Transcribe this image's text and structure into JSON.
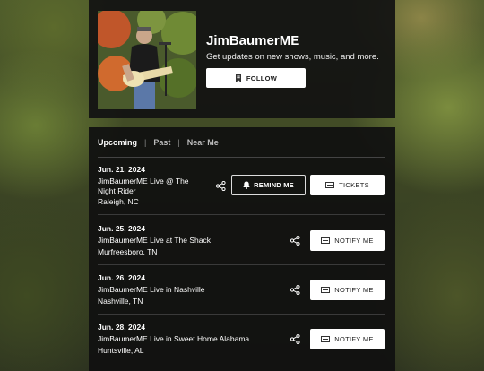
{
  "artist": {
    "name": "JimBaumerME",
    "tagline": "Get updates on new shows, music, and more.",
    "follow_label": "FOLLOW"
  },
  "tabs": [
    {
      "label": "Upcoming",
      "active": true
    },
    {
      "label": "Past",
      "active": false
    },
    {
      "label": "Near Me",
      "active": false
    }
  ],
  "events": [
    {
      "date": "Jun. 21, 2024",
      "title_line1": "JimBaumerME Live @ The",
      "title_line2": "Night Rider",
      "location": "Raleigh, NC",
      "action_label": "REMIND ME",
      "tickets_label": "TICKETS"
    },
    {
      "date": "Jun. 25, 2024",
      "title_line1": "JimBaumerME Live at The Shack",
      "location": "Murfreesboro, TN",
      "action_label": "NOTIFY ME"
    },
    {
      "date": "Jun. 26, 2024",
      "title_line1": "JimBaumerME Live in Nashville",
      "location": "Nashville, TN",
      "action_label": "NOTIFY ME"
    },
    {
      "date": "Jun. 28, 2024",
      "title_line1": "JimBaumerME Live in Sweet Home Alabama",
      "location": "Huntsville, AL",
      "action_label": "NOTIFY ME"
    }
  ],
  "icons": {
    "follow": "bookmark-icon",
    "remind": "bell-icon",
    "tickets": "ticket-icon",
    "share": "share-icon"
  }
}
